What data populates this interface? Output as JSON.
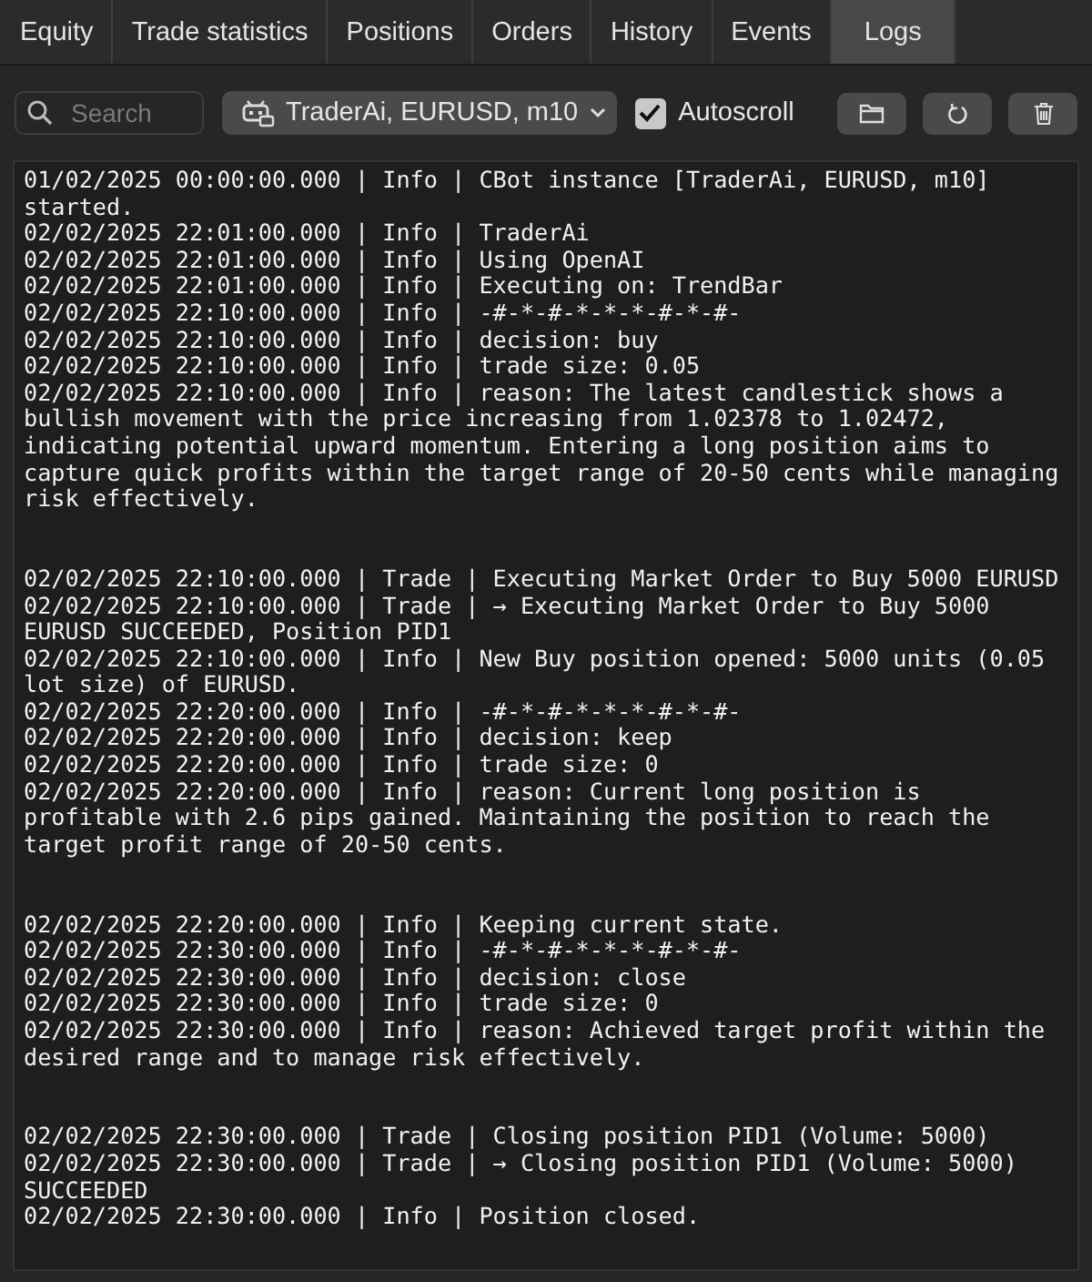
{
  "tabs": [
    {
      "label": "Equity",
      "selected": false
    },
    {
      "label": "Trade statistics",
      "selected": false
    },
    {
      "label": "Positions",
      "selected": false
    },
    {
      "label": "Orders",
      "selected": false
    },
    {
      "label": "History",
      "selected": false
    },
    {
      "label": "Events",
      "selected": false
    },
    {
      "label": "Logs",
      "selected": true
    }
  ],
  "toolbar": {
    "search": {
      "placeholder": "Search"
    },
    "instance_dropdown": {
      "value": "TraderAi, EURUSD, m10"
    },
    "autoscroll": {
      "label": "Autoscroll",
      "checked": true
    }
  },
  "log": {
    "groups": [
      {
        "lines": [
          "01/02/2025 00:00:00.000 | Info | CBot instance [TraderAi, EURUSD, m10] started.",
          "02/02/2025 22:01:00.000 | Info | TraderAi",
          "02/02/2025 22:01:00.000 | Info | Using OpenAI",
          "02/02/2025 22:01:00.000 | Info | Executing on: TrendBar",
          "02/02/2025 22:10:00.000 | Info | -#-*-#-*-*-*-#-*-#-",
          "02/02/2025 22:10:00.000 | Info | decision: buy",
          "02/02/2025 22:10:00.000 | Info | trade size: 0.05",
          "02/02/2025 22:10:00.000 | Info | reason: The latest candlestick shows a bullish movement with the price increasing from 1.02378 to 1.02472, indicating potential upward momentum. Entering a long position aims to capture quick profits within the target range of 20-50 cents while managing risk effectively."
        ]
      },
      {
        "lines": [
          "02/02/2025 22:10:00.000 | Trade | Executing Market Order to Buy 5000 EURUSD",
          "02/02/2025 22:10:00.000 | Trade | → Executing Market Order to Buy 5000 EURUSD SUCCEEDED, Position PID1",
          "02/02/2025 22:10:00.000 | Info | New Buy position opened: 5000 units (0.05 lot size) of EURUSD.",
          "02/02/2025 22:20:00.000 | Info | -#-*-#-*-*-*-#-*-#-",
          "02/02/2025 22:20:00.000 | Info | decision: keep",
          "02/02/2025 22:20:00.000 | Info | trade size: 0",
          "02/02/2025 22:20:00.000 | Info | reason: Current long position is profitable with 2.6 pips gained. Maintaining the position to reach the target profit range of 20-50 cents."
        ]
      },
      {
        "lines": [
          "02/02/2025 22:20:00.000 | Info | Keeping current state.",
          "02/02/2025 22:30:00.000 | Info | -#-*-#-*-*-*-#-*-#-",
          "02/02/2025 22:30:00.000 | Info | decision: close",
          "02/02/2025 22:30:00.000 | Info | trade size: 0",
          "02/02/2025 22:30:00.000 | Info | reason: Achieved target profit within the desired range and to manage risk effectively."
        ]
      },
      {
        "lines": [
          "02/02/2025 22:30:00.000 | Trade | Closing position PID1 (Volume: 5000)",
          "02/02/2025 22:30:00.000 | Trade | → Closing position PID1 (Volume: 5000) SUCCEEDED",
          "02/02/2025 22:30:00.000 | Info | Position closed."
        ]
      }
    ]
  }
}
